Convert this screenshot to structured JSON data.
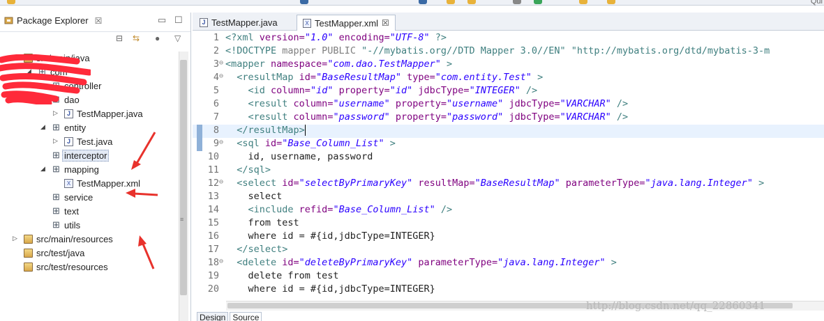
{
  "top_search_hint": "Qui",
  "package_explorer": {
    "title": "Package Explorer",
    "close_glyph": "☒",
    "tree": [
      {
        "label": "src/main/java",
        "level": 1,
        "icon": "source-folder",
        "twisty": "expanded"
      },
      {
        "label": "com",
        "level": 2,
        "icon": "package",
        "twisty": "expanded"
      },
      {
        "label": "controller",
        "level": 3,
        "icon": "package",
        "twisty": "none"
      },
      {
        "label": "dao",
        "level": 3,
        "icon": "package",
        "twisty": "expanded"
      },
      {
        "label": "TestMapper.java",
        "level": 4,
        "icon": "java-interface-file",
        "twisty": "collapsed"
      },
      {
        "label": "entity",
        "level": 3,
        "icon": "package",
        "twisty": "expanded"
      },
      {
        "label": "Test.java",
        "level": 4,
        "icon": "java-file",
        "twisty": "collapsed"
      },
      {
        "label": "interceptor",
        "level": 3,
        "icon": "package",
        "twisty": "none",
        "selected": true
      },
      {
        "label": "mapping",
        "level": 3,
        "icon": "package",
        "twisty": "expanded"
      },
      {
        "label": "TestMapper.xml",
        "level": 4,
        "icon": "xml-file",
        "twisty": "none"
      },
      {
        "label": "service",
        "level": 3,
        "icon": "package",
        "twisty": "none"
      },
      {
        "label": "text",
        "level": 3,
        "icon": "package",
        "twisty": "none"
      },
      {
        "label": "utils",
        "level": 3,
        "icon": "package",
        "twisty": "none"
      },
      {
        "label": "src/main/resources",
        "level": 1,
        "icon": "source-folder",
        "twisty": "collapsed"
      },
      {
        "label": "src/test/java",
        "level": 1,
        "icon": "source-folder",
        "twisty": "none"
      },
      {
        "label": "src/test/resources",
        "level": 1,
        "icon": "source-folder",
        "twisty": "none"
      }
    ]
  },
  "editor": {
    "tabs": [
      {
        "label": "TestMapper.java",
        "icon": "java-file",
        "active": false
      },
      {
        "label": "TestMapper.xml",
        "icon": "xml-file",
        "active": true,
        "close_glyph": "☒"
      }
    ],
    "current_line": 8,
    "lines": [
      {
        "n": "1",
        "fold": "",
        "tokens": [
          [
            "t",
            "<?xml "
          ],
          [
            "a",
            "version="
          ],
          [
            "v",
            "\"1.0\""
          ],
          [
            "t",
            " "
          ],
          [
            "a",
            "encoding="
          ],
          [
            "v",
            "\"UTF-8\""
          ],
          [
            "t",
            " ?>"
          ]
        ]
      },
      {
        "n": "2",
        "fold": "",
        "tokens": [
          [
            "t",
            "<!DOCTYPE "
          ],
          [
            "d",
            "mapper PUBLIC "
          ],
          [
            "t",
            "\"-//mybatis.org//DTD Mapper 3.0//EN\" \"http://mybatis.org/dtd/mybatis-3-m"
          ]
        ]
      },
      {
        "n": "3",
        "fold": "⊖",
        "tokens": [
          [
            "t",
            "<mapper "
          ],
          [
            "a",
            "namespace="
          ],
          [
            "v",
            "\"com.dao.TestMapper\""
          ],
          [
            "t",
            " >"
          ]
        ]
      },
      {
        "n": "4",
        "fold": "⊖",
        "tokens": [
          [
            "t",
            "  <resultMap "
          ],
          [
            "a",
            "id="
          ],
          [
            "v",
            "\"BaseResultMap\""
          ],
          [
            "t",
            " "
          ],
          [
            "a",
            "type="
          ],
          [
            "v",
            "\"com.entity.Test\""
          ],
          [
            "t",
            " >"
          ]
        ]
      },
      {
        "n": "5",
        "fold": "",
        "tokens": [
          [
            "t",
            "    <id "
          ],
          [
            "a",
            "column="
          ],
          [
            "v",
            "\"id\""
          ],
          [
            "t",
            " "
          ],
          [
            "a",
            "property="
          ],
          [
            "v",
            "\"id\""
          ],
          [
            "t",
            " "
          ],
          [
            "a",
            "jdbcType="
          ],
          [
            "v",
            "\"INTEGER\""
          ],
          [
            "t",
            " />"
          ]
        ]
      },
      {
        "n": "6",
        "fold": "",
        "tokens": [
          [
            "t",
            "    <result "
          ],
          [
            "a",
            "column="
          ],
          [
            "v",
            "\"username\""
          ],
          [
            "t",
            " "
          ],
          [
            "a",
            "property="
          ],
          [
            "v",
            "\"username\""
          ],
          [
            "t",
            " "
          ],
          [
            "a",
            "jdbcType="
          ],
          [
            "v",
            "\"VARCHAR\""
          ],
          [
            "t",
            " />"
          ]
        ]
      },
      {
        "n": "7",
        "fold": "",
        "tokens": [
          [
            "t",
            "    <result "
          ],
          [
            "a",
            "column="
          ],
          [
            "v",
            "\"password\""
          ],
          [
            "t",
            " "
          ],
          [
            "a",
            "property="
          ],
          [
            "v",
            "\"password\""
          ],
          [
            "t",
            " "
          ],
          [
            "a",
            "jdbcType="
          ],
          [
            "v",
            "\"VARCHAR\""
          ],
          [
            "t",
            " />"
          ]
        ]
      },
      {
        "n": "8",
        "fold": "",
        "tokens": [
          [
            "t",
            "  </resultMap>"
          ]
        ]
      },
      {
        "n": "9",
        "fold": "⊖",
        "tokens": [
          [
            "t",
            "  <sql "
          ],
          [
            "a",
            "id="
          ],
          [
            "v",
            "\"Base_Column_List\""
          ],
          [
            "t",
            " >"
          ]
        ]
      },
      {
        "n": "10",
        "fold": "",
        "tokens": [
          [
            "p",
            "    id, username, password"
          ]
        ]
      },
      {
        "n": "11",
        "fold": "",
        "tokens": [
          [
            "t",
            "  </sql>"
          ]
        ]
      },
      {
        "n": "12",
        "fold": "⊖",
        "tokens": [
          [
            "t",
            "  <select "
          ],
          [
            "a",
            "id="
          ],
          [
            "v",
            "\"selectByPrimaryKey\""
          ],
          [
            "t",
            " "
          ],
          [
            "a",
            "resultMap="
          ],
          [
            "v",
            "\"BaseResultMap\""
          ],
          [
            "t",
            " "
          ],
          [
            "a",
            "parameterType="
          ],
          [
            "v",
            "\"java.lang.Integer\""
          ],
          [
            "t",
            " >"
          ]
        ]
      },
      {
        "n": "13",
        "fold": "",
        "tokens": [
          [
            "p",
            "    select"
          ]
        ]
      },
      {
        "n": "14",
        "fold": "",
        "tokens": [
          [
            "t",
            "    <include "
          ],
          [
            "a",
            "refid="
          ],
          [
            "v",
            "\"Base_Column_List\""
          ],
          [
            "t",
            " />"
          ]
        ]
      },
      {
        "n": "15",
        "fold": "",
        "tokens": [
          [
            "p",
            "    from test"
          ]
        ]
      },
      {
        "n": "16",
        "fold": "",
        "tokens": [
          [
            "p",
            "    where id = #{id,jdbcType=INTEGER}"
          ]
        ]
      },
      {
        "n": "17",
        "fold": "",
        "tokens": [
          [
            "t",
            "  </select>"
          ]
        ]
      },
      {
        "n": "18",
        "fold": "⊖",
        "tokens": [
          [
            "t",
            "  <delete "
          ],
          [
            "a",
            "id="
          ],
          [
            "v",
            "\"deleteByPrimaryKey\""
          ],
          [
            "t",
            " "
          ],
          [
            "a",
            "parameterType="
          ],
          [
            "v",
            "\"java.lang.Integer\""
          ],
          [
            "t",
            " >"
          ]
        ]
      },
      {
        "n": "19",
        "fold": "",
        "tokens": [
          [
            "p",
            "    delete from test"
          ]
        ]
      },
      {
        "n": "20",
        "fold": "",
        "tokens": [
          [
            "p",
            "    where id = #{id,jdbcType=INTEGER}"
          ]
        ]
      }
    ],
    "bottom_tabs": [
      "Design",
      "Source"
    ],
    "active_bottom_tab": "Source"
  },
  "watermark": "http://blog.csdn.net/qq_22860341",
  "colors": {
    "tag": "#3f7f7f",
    "attribute": "#7f007f",
    "value": "#2a00ff",
    "annotation_arrow": "#e8322c",
    "current_line": "#e8f2fe"
  }
}
